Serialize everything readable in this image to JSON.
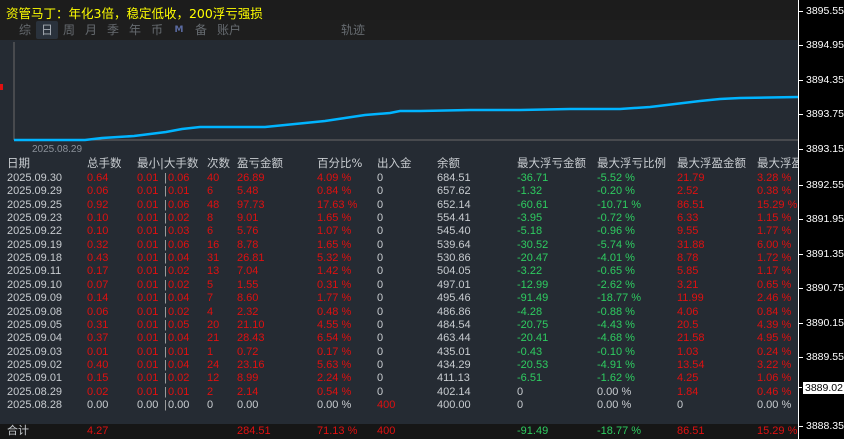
{
  "title": "资管马丁：年化3倍，稳定低收，200浮亏强损",
  "tabs": [
    "综",
    "日",
    "周",
    "月",
    "季",
    "年",
    "币",
    "M",
    "备",
    "账户",
    "轨迹"
  ],
  "active_tab": "日",
  "chart": {
    "x_label": "2025.08.29",
    "line_color": "#00b4ff"
  },
  "y_axis": {
    "ticks": [
      "3895.55",
      "3894.95",
      "3894.35",
      "3893.75",
      "3893.15",
      "3892.55",
      "3891.95",
      "3891.35",
      "3890.75",
      "3890.15",
      "3889.55",
      "3888.35"
    ],
    "current": "3889.02"
  },
  "table": {
    "headers": [
      "日期",
      "总手数",
      "最小|大手数",
      "次数",
      "盈亏金额",
      "百分比%",
      "出入金",
      "余额",
      "最大浮亏金额",
      "最大浮亏比例",
      "最大浮盈金额",
      "最大浮盈"
    ],
    "rows": [
      [
        "2025.09.30",
        "0.64",
        "0.01",
        "0.06",
        "40",
        "26.89",
        "4.09 %",
        "0",
        "684.51",
        "-36.71",
        "-5.52 %",
        "21.79",
        "3.28 %"
      ],
      [
        "2025.09.29",
        "0.06",
        "0.01",
        "0.01",
        "6",
        "5.48",
        "0.84 %",
        "0",
        "657.62",
        "-1.32",
        "-0.20 %",
        "2.52",
        "0.38 %"
      ],
      [
        "2025.09.25",
        "0.92",
        "0.01",
        "0.06",
        "48",
        "97.73",
        "17.63 %",
        "0",
        "652.14",
        "-60.61",
        "-10.71 %",
        "86.51",
        "15.29 %"
      ],
      [
        "2025.09.23",
        "0.10",
        "0.01",
        "0.02",
        "8",
        "9.01",
        "1.65 %",
        "0",
        "554.41",
        "-3.95",
        "-0.72 %",
        "6.33",
        "1.15 %"
      ],
      [
        "2025.09.22",
        "0.10",
        "0.01",
        "0.03",
        "6",
        "5.76",
        "1.07 %",
        "0",
        "545.40",
        "-5.18",
        "-0.96 %",
        "9.55",
        "1.77 %"
      ],
      [
        "2025.09.19",
        "0.32",
        "0.01",
        "0.06",
        "16",
        "8.78",
        "1.65 %",
        "0",
        "539.64",
        "-30.52",
        "-5.74 %",
        "31.88",
        "6.00 %"
      ],
      [
        "2025.09.18",
        "0.43",
        "0.01",
        "0.04",
        "31",
        "26.81",
        "5.32 %",
        "0",
        "530.86",
        "-20.47",
        "-4.01 %",
        "8.78",
        "1.72 %"
      ],
      [
        "2025.09.11",
        "0.17",
        "0.01",
        "0.02",
        "13",
        "7.04",
        "1.42 %",
        "0",
        "504.05",
        "-3.22",
        "-0.65 %",
        "5.85",
        "1.17 %"
      ],
      [
        "2025.09.10",
        "0.07",
        "0.01",
        "0.02",
        "5",
        "1.55",
        "0.31 %",
        "0",
        "497.01",
        "-12.99",
        "-2.62 %",
        "3.21",
        "0.65 %"
      ],
      [
        "2025.09.09",
        "0.14",
        "0.01",
        "0.04",
        "7",
        "8.60",
        "1.77 %",
        "0",
        "495.46",
        "-91.49",
        "-18.77 %",
        "11.99",
        "2.46 %"
      ],
      [
        "2025.09.08",
        "0.06",
        "0.01",
        "0.02",
        "4",
        "2.32",
        "0.48 %",
        "0",
        "486.86",
        "-4.28",
        "-0.88 %",
        "4.06",
        "0.84 %"
      ],
      [
        "2025.09.05",
        "0.31",
        "0.01",
        "0.05",
        "20",
        "21.10",
        "4.55 %",
        "0",
        "484.54",
        "-20.75",
        "-4.43 %",
        "20.5",
        "4.39 %"
      ],
      [
        "2025.09.04",
        "0.37",
        "0.01",
        "0.04",
        "21",
        "28.43",
        "6.54 %",
        "0",
        "463.44",
        "-20.41",
        "-4.68 %",
        "21.58",
        "4.95 %"
      ],
      [
        "2025.09.03",
        "0.01",
        "0.01",
        "0.01",
        "1",
        "0.72",
        "0.17 %",
        "0",
        "435.01",
        "-0.43",
        "-0.10 %",
        "1.03",
        "0.24 %"
      ],
      [
        "2025.09.02",
        "0.40",
        "0.01",
        "0.04",
        "24",
        "23.16",
        "5.63 %",
        "0",
        "434.29",
        "-20.53",
        "-4.91 %",
        "13.54",
        "3.22 %"
      ],
      [
        "2025.09.01",
        "0.15",
        "0.01",
        "0.02",
        "12",
        "8.99",
        "2.24 %",
        "0",
        "411.13",
        "-6.51",
        "-1.62 %",
        "4.25",
        "1.06 %"
      ],
      [
        "2025.08.29",
        "0.02",
        "0.01",
        "0.01",
        "2",
        "2.14",
        "0.54 %",
        "0",
        "402.14",
        "0",
        "0.00 %",
        "1.84",
        "0.46 %"
      ],
      [
        "2025.08.28",
        "0.00",
        "0.00",
        "0.00",
        "0",
        "0.00",
        "0.00 %",
        "400",
        "400.00",
        "0",
        "0.00 %",
        "0",
        "0.00 %"
      ]
    ],
    "total": {
      "label": "合计",
      "lots": "4.27",
      "pnl": "284.51",
      "pct": "71.13 %",
      "deposit": "400",
      "max_loss": "-91.49",
      "max_loss_pct": "-18.77 %",
      "max_profit": "86.51",
      "max_profit_pct": "15.29 %"
    }
  }
}
